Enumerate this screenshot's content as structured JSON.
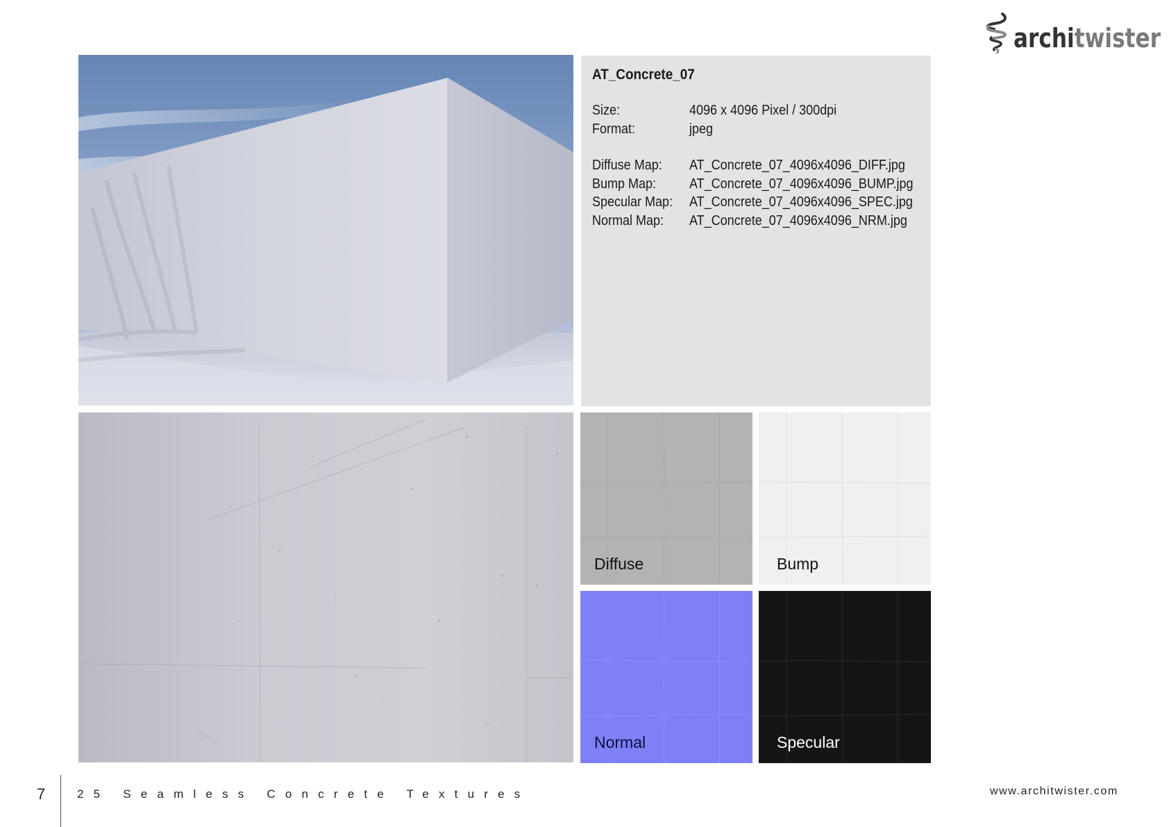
{
  "brand": {
    "logo_part1": "archi",
    "logo_part2": "twister",
    "logo_icon": "twister-swirl-icon",
    "colors": {
      "dark": "#333333",
      "light": "#7a7a7a"
    }
  },
  "hero": {
    "alt": "Rendered concrete wall corner under blue sky",
    "icon": "concrete-wall-photo"
  },
  "info": {
    "title": "AT_Concrete_07",
    "specs": [
      {
        "key": "Size:",
        "value": "4096 x 4096 Pixel / 300dpi"
      },
      {
        "key": "Format:",
        "value": "jpeg"
      }
    ],
    "maps": [
      {
        "key": "Diffuse Map:",
        "value": "AT_Concrete_07_4096x4096_DIFF.jpg"
      },
      {
        "key": "Bump Map:",
        "value": "AT_Concrete_07_4096x4096_BUMP.jpg"
      },
      {
        "key": "Specular Map:",
        "value": "AT_Concrete_07_4096x4096_SPEC.jpg"
      },
      {
        "key": "Normal Map:",
        "value": "AT_Concrete_07_4096x4096_NRM.jpg"
      }
    ]
  },
  "texture": {
    "alt": "Seamless concrete texture close-up"
  },
  "swatches": [
    {
      "label": "Diffuse",
      "color": "#b3b3b3"
    },
    {
      "label": "Bump",
      "color": "#f0f0f0"
    },
    {
      "label": "Normal",
      "color": "#7f80f6"
    },
    {
      "label": "Specular",
      "color": "#151515"
    }
  ],
  "footer": {
    "page_number": "7",
    "title": "25 Seamless Concrete Textures",
    "url": "www.architwister.com"
  }
}
